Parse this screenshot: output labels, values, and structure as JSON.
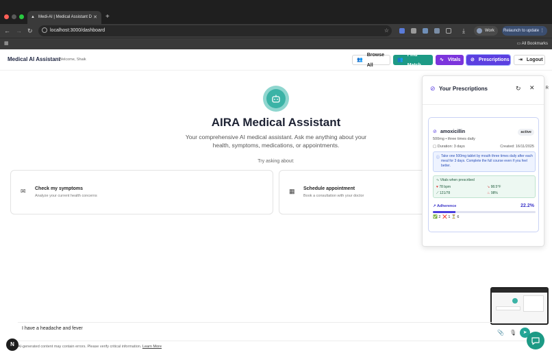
{
  "browser": {
    "tab_title": "Medi-AI | Medical Assistant D",
    "url": "localhost:3000/dashboard",
    "profile_label": "Work",
    "update_label": "Relaunch to update",
    "bookmarks_label": "All Bookmarks"
  },
  "header": {
    "app_name": "Medical AI Assistant",
    "welcome": "Welcome, Shaik",
    "buttons": {
      "browse": "Browse All",
      "find": "Find Match",
      "vitals": "Vitals",
      "prescriptions": "Prescriptions",
      "logout": "Logout"
    }
  },
  "hero": {
    "title": "AIRA Medical Assistant",
    "subtitle": "Your comprehensive AI medical assistant. Ask me anything about your health, symptoms, medications, or appointments.",
    "try_label": "Try asking about:"
  },
  "cards": [
    {
      "title": "Check my symptoms",
      "desc": "Analyze your current health concerns"
    },
    {
      "title": "Schedule appointment",
      "desc": "Book a consultation with your doctor"
    }
  ],
  "prescriptions_panel": {
    "title": "Your Prescriptions",
    "side_tab": "R",
    "item": {
      "drug": "amoxicillin",
      "status": "active",
      "dose": "500mg • three times daily",
      "duration": "Duration: 3 days",
      "created": "Created: 16/11/2025",
      "instructions": "Take one 500mg tablet by mouth three times daily after each meal for 3 days. Complete the full course even if you feel better.",
      "vitals_heading": "Vitals when prescribed",
      "vitals": {
        "heart_rate": "78 bpm",
        "temperature": "98.5°F",
        "bp": "121/78",
        "spo2": "98%"
      },
      "adherence_label": "Adherence",
      "adherence_pct": "22.2%",
      "adherence_fraction": 0.222,
      "counts": {
        "taken": "2",
        "missed": "1",
        "pending": "6"
      }
    }
  },
  "chat": {
    "input_value": "I have a headache and fever",
    "disclaimer": "AI-generated content may contain errors. Please verify critical information.",
    "learn_more": "Learn More"
  },
  "colors": {
    "teal": "#1d9a85",
    "purple": "#7c34dc",
    "indigo": "#5b3fe0"
  }
}
